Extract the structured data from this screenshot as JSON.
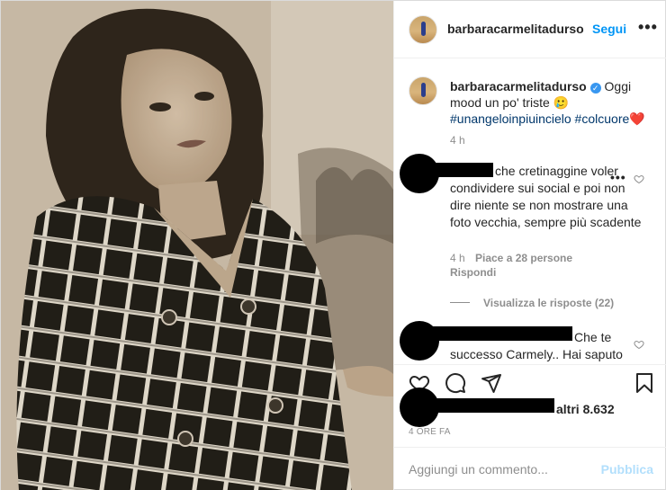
{
  "header": {
    "username": "barbaracarmelitadurso",
    "follow_label": "Segui",
    "more_label": "•••"
  },
  "caption": {
    "username": "barbaracarmelitadurso",
    "text": "Oggi mood un po' triste 🥲",
    "hashtags": "#unangeloinpiuincielo #colcuore❤️",
    "time": "4 h"
  },
  "comments": [
    {
      "text": "che cretinaggine voler condividere sui social e poi non dire niente se non mostrare una foto vecchia, sempre più scadente",
      "time": "4 h",
      "likes": "Piace a 28 persone",
      "reply": "Rispondi",
      "view_replies": "Visualizza le risposte (22)"
    },
    {
      "text": "Che te successo Carmely.. Hai saputo"
    }
  ],
  "likes": {
    "text": "altri 8.632"
  },
  "timeago": "4 ORE FA",
  "add_comment": {
    "placeholder": "Aggiungi un commento...",
    "publish_label": "Pubblica"
  },
  "colors": {
    "accent": "#0095f6",
    "text": "#262626",
    "muted": "#8e8e8e",
    "link": "#00376b",
    "publish_disabled": "#b2dffc"
  },
  "icons": [
    "heart-icon",
    "comment-icon",
    "share-icon",
    "bookmark-icon",
    "verified-icon"
  ]
}
